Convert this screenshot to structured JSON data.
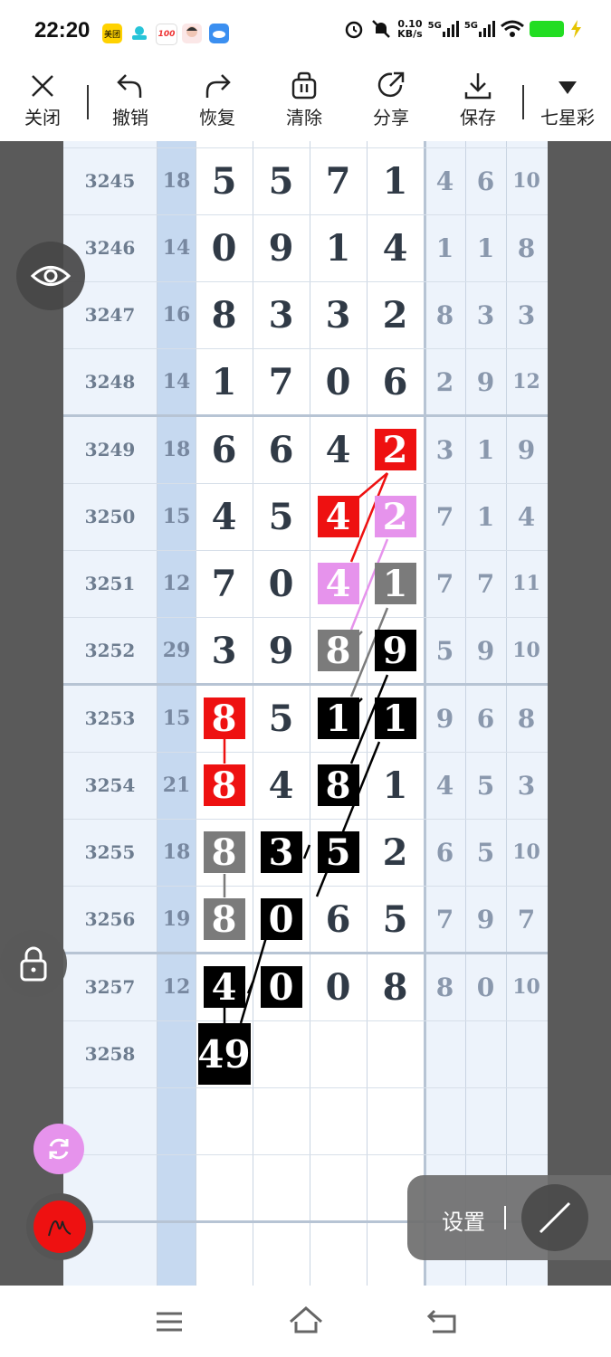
{
  "status": {
    "time": "22:20",
    "app1": "美团",
    "app3": "100",
    "net_speed": "0.10",
    "net_unit": "KB/s",
    "sig1": "5G",
    "sig2": "5G"
  },
  "toolbar": {
    "close": "关闭",
    "undo": "撤销",
    "redo": "恢复",
    "clear": "清除",
    "share": "分享",
    "save": "保存",
    "lottery": "七星彩"
  },
  "rows": [
    {
      "issue": "3245",
      "sum": "18",
      "d": [
        "5",
        "5",
        "7",
        "1"
      ],
      "s": [
        "4",
        "6",
        "10"
      ]
    },
    {
      "issue": "3246",
      "sum": "14",
      "d": [
        "0",
        "9",
        "1",
        "4"
      ],
      "s": [
        "1",
        "1",
        "8"
      ]
    },
    {
      "issue": "3247",
      "sum": "16",
      "d": [
        "8",
        "3",
        "3",
        "2"
      ],
      "s": [
        "8",
        "3",
        "3"
      ]
    },
    {
      "issue": "3248",
      "sum": "14",
      "d": [
        "1",
        "7",
        "0",
        "6"
      ],
      "s": [
        "2",
        "9",
        "12"
      ]
    },
    {
      "issue": "3249",
      "sum": "18",
      "d": [
        "6",
        "6",
        "4",
        "2"
      ],
      "s": [
        "3",
        "1",
        "9"
      ]
    },
    {
      "issue": "3250",
      "sum": "15",
      "d": [
        "4",
        "5",
        "4",
        "2"
      ],
      "s": [
        "7",
        "1",
        "4"
      ]
    },
    {
      "issue": "3251",
      "sum": "12",
      "d": [
        "7",
        "0",
        "4",
        "1"
      ],
      "s": [
        "7",
        "7",
        "11"
      ]
    },
    {
      "issue": "3252",
      "sum": "29",
      "d": [
        "3",
        "9",
        "8",
        "9"
      ],
      "s": [
        "5",
        "9",
        "10"
      ]
    },
    {
      "issue": "3253",
      "sum": "15",
      "d": [
        "8",
        "5",
        "1",
        "1"
      ],
      "s": [
        "9",
        "6",
        "8"
      ]
    },
    {
      "issue": "3254",
      "sum": "21",
      "d": [
        "8",
        "4",
        "8",
        "1"
      ],
      "s": [
        "4",
        "5",
        "3"
      ]
    },
    {
      "issue": "3255",
      "sum": "18",
      "d": [
        "8",
        "3",
        "5",
        "2"
      ],
      "s": [
        "6",
        "5",
        "10"
      ]
    },
    {
      "issue": "3256",
      "sum": "19",
      "d": [
        "8",
        "0",
        "6",
        "5"
      ],
      "s": [
        "7",
        "9",
        "7"
      ]
    },
    {
      "issue": "3257",
      "sum": "12",
      "d": [
        "4",
        "0",
        "0",
        "8"
      ],
      "s": [
        "8",
        "0",
        "10"
      ]
    },
    {
      "issue": "3258",
      "sum": "",
      "d": [
        "49",
        "",
        "",
        ""
      ],
      "s": [
        "",
        "",
        ""
      ]
    }
  ],
  "settings": {
    "label": "设置"
  },
  "colors": {
    "red": "#ee1111",
    "pink": "#e693ec",
    "gray": "#7b7b7b",
    "black": "#000000",
    "sum_column": "#c6d9f0"
  }
}
